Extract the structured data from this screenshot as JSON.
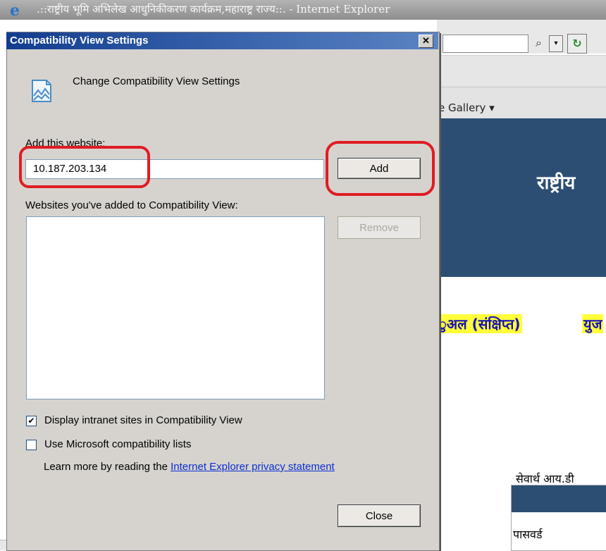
{
  "ie": {
    "title": ".::राष्ट्रीय भूमि अभिलेख आधुनिकीकरण कार्यक्रम,महाराष्ट्र राज्य::. - Internet Explorer",
    "logo_glyph": "e",
    "search_glyph": "⌕",
    "dropdown_glyph": "▾",
    "refresh_glyph": "↻",
    "favorites_gallery": "e Gallery ▾",
    "page_heading": "राष्ट्रीय",
    "link_manual": "ुअल (संक्षिप्त)",
    "link_user": "युज",
    "login_user_label": "सेवार्थ आय.डी",
    "login_password_label": "पासवर्ड"
  },
  "dialog": {
    "title": "Compatibility View Settings",
    "close_glyph": "✕",
    "subtitle": "Change Compatibility View Settings",
    "add_label": "Add this website:",
    "website_value": "10.187.203.134",
    "add_button": "Add",
    "list_label": "Websites you've added to Compatibility View:",
    "websites": [],
    "remove_button": "Remove",
    "checkbox_intranet": {
      "label": "Display intranet sites in Compatibility View",
      "checked": true,
      "mark": "✔"
    },
    "checkbox_mslists": {
      "label": "Use Microsoft compatibility lists",
      "checked": false,
      "mark": ""
    },
    "learn_more_text": "Learn more by reading the ",
    "learn_more_link": "Internet Explorer privacy statement",
    "close_button": "Close"
  },
  "colors": {
    "dialog_bg": "#d6d3ce",
    "title_gradient_start": "#123d8f",
    "highlight": "#e01c24",
    "page_banner": "#2c4e73",
    "link_color": "#0a2ed0"
  }
}
